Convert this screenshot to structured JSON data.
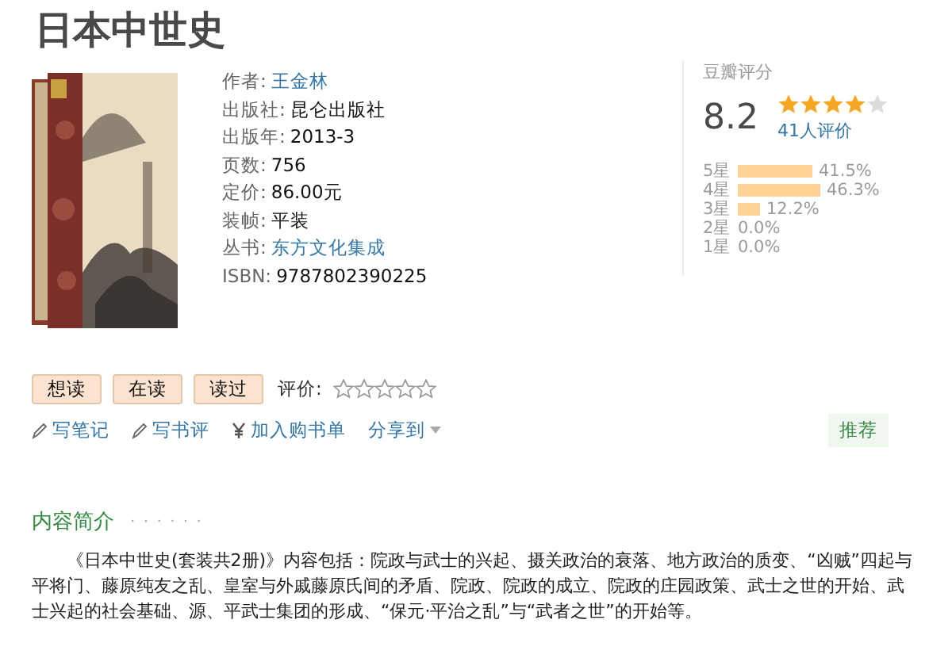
{
  "title": "日本中世史",
  "info": [
    {
      "label": "作者:",
      "value": "王金林",
      "kind": "link"
    },
    {
      "label": "出版社:",
      "value": "昆仑出版社",
      "kind": "text"
    },
    {
      "label": "出版年:",
      "value": "2013-3",
      "kind": "text"
    },
    {
      "label": "页数:",
      "value": "756",
      "kind": "text"
    },
    {
      "label": "定价:",
      "value": "86.00元",
      "kind": "text"
    },
    {
      "label": "装帧:",
      "value": "平装",
      "kind": "text"
    },
    {
      "label": "丛书:",
      "value": "东方文化集成",
      "kind": "link"
    },
    {
      "label": "ISBN:",
      "value": "9787802390225",
      "kind": "text"
    }
  ],
  "rating": {
    "heading": "豆瓣评分",
    "score": "8.2",
    "stars": 4,
    "count": "41人评价",
    "histogram": [
      {
        "label": "5星",
        "percent": "41.5%"
      },
      {
        "label": "4星",
        "percent": "46.3%"
      },
      {
        "label": "3星",
        "percent": "12.2%"
      },
      {
        "label": "2星",
        "percent": "0.0%"
      },
      {
        "label": "1星",
        "percent": "0.0%"
      }
    ]
  },
  "status_buttons": [
    "想读",
    "在读",
    "读过"
  ],
  "my_rating": {
    "label": "评价:",
    "stars": 0
  },
  "actions": [
    {
      "label": "写笔记"
    },
    {
      "label": "写书评"
    },
    {
      "label": "加入购书单"
    },
    {
      "label": "分享到"
    }
  ],
  "recommend": "推荐",
  "intro": {
    "heading": "内容简介",
    "dots": "· · · · · ·",
    "text": "《日本中世史(套装共2册)》内容包括：院政与武士的兴起、摄关政治的衰落、地方政治的质变、“凶贼”四起与平将门、藤原纯友之乱、皇室与外戚藤原氏间的矛盾、院政、院政的成立、院政的庄园政策、武士之世的开始、武士兴起的社会基础、源、平武士集团的形成、“保元·平治之乱”与“武者之世”的开始等。"
  }
}
